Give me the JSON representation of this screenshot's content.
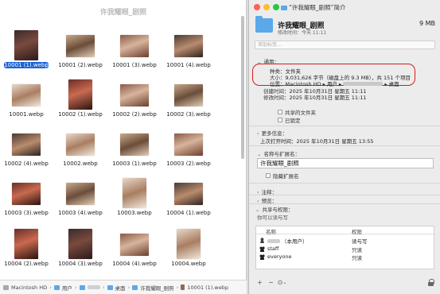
{
  "finder": {
    "title": "许我耀眼_剧照",
    "files": [
      {
        "label": "10001 (1).webp",
        "thumb": "t1",
        "wide": false,
        "selected": true
      },
      {
        "label": "10001 (2).webp",
        "thumb": "t2",
        "wide": true,
        "selected": false
      },
      {
        "label": "10001 (3).webp",
        "thumb": "t3",
        "wide": true,
        "selected": false
      },
      {
        "label": "10001 (4).webp",
        "thumb": "t4",
        "wide": true,
        "selected": false
      },
      {
        "label": "10001.webp",
        "thumb": "t5",
        "wide": true,
        "selected": false
      },
      {
        "label": "10002 (1).webp",
        "thumb": "t6",
        "wide": false,
        "selected": false
      },
      {
        "label": "10002 (2).webp",
        "thumb": "t3",
        "wide": true,
        "selected": false
      },
      {
        "label": "10002 (3).webp",
        "thumb": "t2",
        "wide": true,
        "selected": false
      },
      {
        "label": "10002 (4).webp",
        "thumb": "t4",
        "wide": true,
        "selected": false
      },
      {
        "label": "10002.webp",
        "thumb": "t5",
        "wide": true,
        "selected": false
      },
      {
        "label": "10003 (1).webp",
        "thumb": "t2",
        "wide": true,
        "selected": false
      },
      {
        "label": "10003 (2).webp",
        "thumb": "t3",
        "wide": true,
        "selected": false
      },
      {
        "label": "10003 (3).webp",
        "thumb": "t6",
        "wide": true,
        "selected": false
      },
      {
        "label": "10003 (4).webp",
        "thumb": "t2",
        "wide": true,
        "selected": false
      },
      {
        "label": "10003.webp",
        "thumb": "t5",
        "wide": false,
        "selected": false
      },
      {
        "label": "10004 (1).webp",
        "thumb": "t4",
        "wide": true,
        "selected": false
      },
      {
        "label": "10004 (2).webp",
        "thumb": "t6",
        "wide": false,
        "selected": false
      },
      {
        "label": "10004 (3).webp",
        "thumb": "t1",
        "wide": false,
        "selected": false
      },
      {
        "label": "10004 (4).webp",
        "thumb": "t3",
        "wide": true,
        "selected": false
      },
      {
        "label": "10004.webp",
        "thumb": "t5",
        "wide": false,
        "selected": false
      }
    ],
    "pathbar": {
      "disk": "Macintosh HD",
      "users": "用户",
      "desktop": "桌面",
      "folder": "许我耀眼_剧照",
      "file": "10001 (1).webp"
    }
  },
  "info": {
    "title": "“许我耀眼_剧照”简介",
    "name": "许我耀眼_剧照",
    "size": "9 MB",
    "modified_short": "修改时间：今天 11:11",
    "tags_placeholder": "添加标签…",
    "general": {
      "header": "通用：",
      "kind_label": "种类：",
      "kind_value": "文件夹",
      "size_label": "大小：",
      "size_value": "9,031,626 字节（磁盘上的 9.3 MB），共 151 个项目",
      "where_label": "位置：",
      "where_value_a": "Macintosh HD ▸ 用户 ▸",
      "where_value_b": "▸ 桌面",
      "created_label": "创建时间：",
      "created_value": "2025 年10月31日 星期五 11:11",
      "modified_label": "修改时间：",
      "modified_value": "2025 年10月31日 星期五 11:11",
      "shared_label": "共享的文件夹",
      "locked_label": "已锁定"
    },
    "more": {
      "header": "更多信息：",
      "last_opened": "上次打开时间：2025 年10月31日 星期五 13:55"
    },
    "name_ext": {
      "header": "名称与扩展名：",
      "value": "许我耀眼_剧照",
      "hide_ext": "隐藏扩展名"
    },
    "comments_header": "注释：",
    "preview_header": "预览：",
    "sharing": {
      "header": "共享与权限：",
      "subtitle": "你可以读与写",
      "col_name": "名称",
      "col_perm": "权限",
      "rows": [
        {
          "name": "（本用户）",
          "perm": "读与写",
          "icon": "person"
        },
        {
          "name": "staff",
          "perm": "只读",
          "icon": "group"
        },
        {
          "name": "everyone",
          "perm": "只读",
          "icon": "group"
        }
      ]
    },
    "tools": {
      "add": "+",
      "remove": "−",
      "action": "⊙",
      "action_caret": "⌄"
    }
  }
}
